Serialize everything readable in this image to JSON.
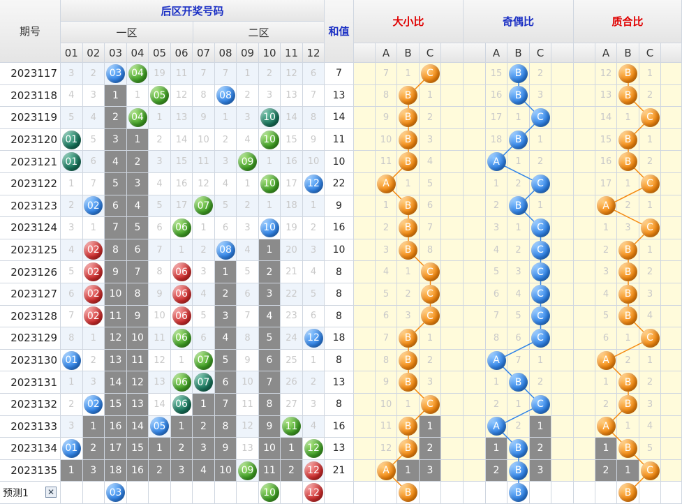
{
  "header": {
    "period_label": "期号",
    "back_zone_title": "后区开奖号码",
    "zone1_label": "一区",
    "zone2_label": "二区",
    "sum_label": "和值",
    "size_ratio_label": "大小比",
    "odd_even_label": "奇偶比",
    "prime_composite_label": "质合比",
    "number_columns": [
      "01",
      "02",
      "03",
      "04",
      "05",
      "06",
      "07",
      "08",
      "09",
      "10",
      "11",
      "12"
    ],
    "abc": [
      "A",
      "B",
      "C"
    ]
  },
  "chart_data": {
    "type": "table",
    "rows": [
      {
        "period": "2023117",
        "cells": [
          "3",
          "2",
          "03",
          "04",
          "19",
          "11",
          "7",
          "7",
          "1",
          "2",
          "12",
          "6"
        ],
        "sum": "7",
        "size": [
          "7",
          "1",
          "C"
        ],
        "parity": [
          "15",
          "B",
          "2"
        ],
        "prime": [
          "12",
          "B",
          "1"
        ]
      },
      {
        "period": "2023118",
        "cells": [
          "4",
          "3",
          "1",
          "1",
          "05",
          "12",
          "8",
          "08",
          "2",
          "3",
          "13",
          "7"
        ],
        "sum": "13",
        "size": [
          "8",
          "B",
          "1"
        ],
        "parity": [
          "16",
          "B",
          "3"
        ],
        "prime": [
          "13",
          "B",
          "2"
        ]
      },
      {
        "period": "2023119",
        "cells": [
          "5",
          "4",
          "2",
          "04",
          "1",
          "13",
          "9",
          "1",
          "3",
          "10",
          "14",
          "8"
        ],
        "sum": "14",
        "size": [
          "9",
          "B",
          "2"
        ],
        "parity": [
          "17",
          "1",
          "C"
        ],
        "prime": [
          "14",
          "1",
          "C"
        ]
      },
      {
        "period": "2023120",
        "cells": [
          "01",
          "5",
          "3",
          "1",
          "2",
          "14",
          "10",
          "2",
          "4",
          "10",
          "15",
          "9"
        ],
        "sum": "11",
        "size": [
          "10",
          "B",
          "3"
        ],
        "parity": [
          "18",
          "B",
          "1"
        ],
        "prime": [
          "15",
          "B",
          "1"
        ]
      },
      {
        "period": "2023121",
        "cells": [
          "01",
          "6",
          "4",
          "2",
          "3",
          "15",
          "11",
          "3",
          "09",
          "1",
          "16",
          "10"
        ],
        "sum": "10",
        "size": [
          "11",
          "B",
          "4"
        ],
        "parity": [
          "A",
          "1",
          "2"
        ],
        "prime": [
          "16",
          "B",
          "2"
        ]
      },
      {
        "period": "2023122",
        "cells": [
          "1",
          "7",
          "5",
          "3",
          "4",
          "16",
          "12",
          "4",
          "1",
          "10",
          "17",
          "12"
        ],
        "sum": "22",
        "size": [
          "A",
          "1",
          "5"
        ],
        "parity": [
          "1",
          "2",
          "C"
        ],
        "prime": [
          "17",
          "1",
          "C"
        ]
      },
      {
        "period": "2023123",
        "cells": [
          "2",
          "02",
          "6",
          "4",
          "5",
          "17",
          "07",
          "5",
          "2",
          "1",
          "18",
          "1"
        ],
        "sum": "9",
        "size": [
          "1",
          "B",
          "6"
        ],
        "parity": [
          "2",
          "B",
          "1"
        ],
        "prime": [
          "A",
          "2",
          "1"
        ]
      },
      {
        "period": "2023124",
        "cells": [
          "3",
          "1",
          "7",
          "5",
          "6",
          "06",
          "1",
          "6",
          "3",
          "10",
          "19",
          "2"
        ],
        "sum": "16",
        "size": [
          "2",
          "B",
          "7"
        ],
        "parity": [
          "3",
          "1",
          "C"
        ],
        "prime": [
          "1",
          "3",
          "C"
        ]
      },
      {
        "period": "2023125",
        "cells": [
          "4",
          "02",
          "8",
          "6",
          "7",
          "1",
          "2",
          "08",
          "4",
          "1",
          "20",
          "3"
        ],
        "sum": "10",
        "size": [
          "3",
          "B",
          "8"
        ],
        "parity": [
          "4",
          "2",
          "C"
        ],
        "prime": [
          "2",
          "B",
          "1"
        ]
      },
      {
        "period": "2023126",
        "cells": [
          "5",
          "02",
          "9",
          "7",
          "8",
          "06",
          "3",
          "1",
          "5",
          "2",
          "21",
          "4"
        ],
        "sum": "8",
        "size": [
          "4",
          "1",
          "C"
        ],
        "parity": [
          "5",
          "3",
          "C"
        ],
        "prime": [
          "3",
          "B",
          "2"
        ]
      },
      {
        "period": "2023127",
        "cells": [
          "6",
          "02",
          "10",
          "8",
          "9",
          "06",
          "4",
          "2",
          "6",
          "3",
          "22",
          "5"
        ],
        "sum": "8",
        "size": [
          "5",
          "2",
          "C"
        ],
        "parity": [
          "6",
          "4",
          "C"
        ],
        "prime": [
          "4",
          "B",
          "3"
        ]
      },
      {
        "period": "2023128",
        "cells": [
          "7",
          "02",
          "11",
          "9",
          "10",
          "06",
          "5",
          "3",
          "7",
          "4",
          "23",
          "6"
        ],
        "sum": "8",
        "size": [
          "6",
          "3",
          "C"
        ],
        "parity": [
          "7",
          "5",
          "C"
        ],
        "prime": [
          "5",
          "B",
          "4"
        ]
      },
      {
        "period": "2023129",
        "cells": [
          "8",
          "1",
          "12",
          "10",
          "11",
          "06",
          "6",
          "4",
          "8",
          "5",
          "24",
          "12"
        ],
        "sum": "18",
        "size": [
          "7",
          "B",
          "1"
        ],
        "parity": [
          "8",
          "6",
          "C"
        ],
        "prime": [
          "6",
          "1",
          "C"
        ]
      },
      {
        "period": "2023130",
        "cells": [
          "01",
          "2",
          "13",
          "11",
          "12",
          "1",
          "07",
          "5",
          "9",
          "6",
          "25",
          "1"
        ],
        "sum": "8",
        "size": [
          "8",
          "B",
          "2"
        ],
        "parity": [
          "A",
          "7",
          "1"
        ],
        "prime": [
          "A",
          "2",
          "1"
        ]
      },
      {
        "period": "2023131",
        "cells": [
          "1",
          "3",
          "14",
          "12",
          "13",
          "06",
          "07",
          "6",
          "10",
          "7",
          "26",
          "2"
        ],
        "sum": "13",
        "size": [
          "9",
          "B",
          "3"
        ],
        "parity": [
          "1",
          "B",
          "2"
        ],
        "prime": [
          "1",
          "B",
          "2"
        ]
      },
      {
        "period": "2023132",
        "cells": [
          "2",
          "02",
          "15",
          "13",
          "14",
          "06",
          "1",
          "7",
          "11",
          "8",
          "27",
          "3"
        ],
        "sum": "8",
        "size": [
          "10",
          "1",
          "C"
        ],
        "parity": [
          "2",
          "1",
          "C"
        ],
        "prime": [
          "2",
          "B",
          "3"
        ]
      },
      {
        "period": "2023133",
        "cells": [
          "3",
          "1",
          "16",
          "14",
          "05",
          "1",
          "2",
          "8",
          "12",
          "9",
          "11",
          "4"
        ],
        "sum": "16",
        "size": [
          "11",
          "B",
          "1"
        ],
        "parity": [
          "A",
          "2",
          "1"
        ],
        "prime": [
          "A",
          "1",
          "4"
        ]
      },
      {
        "period": "2023134",
        "cells": [
          "01",
          "2",
          "17",
          "15",
          "1",
          "2",
          "3",
          "9",
          "13",
          "10",
          "1",
          "12"
        ],
        "sum": "13",
        "size": [
          "12",
          "B",
          "2"
        ],
        "parity": [
          "1",
          "B",
          "2"
        ],
        "prime": [
          "1",
          "B",
          "5"
        ]
      },
      {
        "period": "2023135",
        "cells": [
          "1",
          "3",
          "18",
          "16",
          "2",
          "3",
          "4",
          "10",
          "09",
          "11",
          "2",
          "12"
        ],
        "sum": "21",
        "size": [
          "A",
          "1",
          "3"
        ],
        "parity": [
          "2",
          "B",
          "3"
        ],
        "prime": [
          "2",
          "1",
          "C"
        ]
      }
    ],
    "cell_styles": [
      [
        "n",
        "n",
        "blue",
        "green",
        "n",
        "n",
        "n",
        "n",
        "n",
        "n",
        "n",
        "n"
      ],
      [
        "n",
        "n",
        "gray",
        "n",
        "green",
        "n",
        "n",
        "blue",
        "n",
        "n",
        "n",
        "n"
      ],
      [
        "n",
        "n",
        "gray",
        "green",
        "n",
        "n",
        "n",
        "n",
        "n",
        "teal",
        "n",
        "n"
      ],
      [
        "teal",
        "n",
        "gray",
        "gray",
        "n",
        "n",
        "n",
        "n",
        "n",
        "green",
        "n",
        "n"
      ],
      [
        "teal",
        "n",
        "gray",
        "gray",
        "n",
        "n",
        "n",
        "n",
        "green",
        "n",
        "n",
        "n"
      ],
      [
        "n",
        "n",
        "gray",
        "gray",
        "n",
        "n",
        "n",
        "n",
        "n",
        "green",
        "n",
        "blue"
      ],
      [
        "n",
        "blue",
        "gray",
        "gray",
        "n",
        "n",
        "green",
        "n",
        "n",
        "n",
        "n",
        "n"
      ],
      [
        "n",
        "n",
        "gray",
        "gray",
        "n",
        "green",
        "n",
        "n",
        "n",
        "blue",
        "n",
        "n"
      ],
      [
        "n",
        "red",
        "gray",
        "gray",
        "n",
        "n",
        "n",
        "blue",
        "n",
        "gray",
        "n",
        "n"
      ],
      [
        "n",
        "red",
        "gray",
        "gray",
        "n",
        "red",
        "n",
        "gray",
        "n",
        "gray",
        "n",
        "n"
      ],
      [
        "n",
        "red",
        "gray",
        "gray",
        "n",
        "red",
        "n",
        "gray",
        "n",
        "gray",
        "n",
        "n"
      ],
      [
        "n",
        "red",
        "gray",
        "gray",
        "n",
        "red",
        "n",
        "gray",
        "n",
        "gray",
        "n",
        "n"
      ],
      [
        "n",
        "n",
        "gray",
        "gray",
        "n",
        "green",
        "n",
        "gray",
        "n",
        "gray",
        "n",
        "blue"
      ],
      [
        "blue",
        "n",
        "gray",
        "gray",
        "n",
        "n",
        "green",
        "gray",
        "n",
        "gray",
        "n",
        "n"
      ],
      [
        "n",
        "n",
        "gray",
        "gray",
        "n",
        "green",
        "teal",
        "gray",
        "n",
        "gray",
        "n",
        "n"
      ],
      [
        "n",
        "blue",
        "gray",
        "gray",
        "n",
        "teal",
        "gray",
        "gray",
        "n",
        "gray",
        "n",
        "n"
      ],
      [
        "n",
        "gray",
        "gray",
        "gray",
        "blue",
        "gray",
        "gray",
        "gray",
        "n",
        "gray",
        "green",
        "n"
      ],
      [
        "blue",
        "gray",
        "gray",
        "gray",
        "gray",
        "gray",
        "gray",
        "gray",
        "n",
        "gray",
        "gray",
        "green"
      ],
      [
        "gray",
        "gray",
        "gray",
        "gray",
        "gray",
        "gray",
        "gray",
        "gray",
        "green",
        "gray",
        "gray",
        "red"
      ]
    ],
    "ratio_styles": {
      "size": [
        [
          "n",
          "n",
          "ball"
        ],
        [
          "n",
          "ball",
          "n"
        ],
        [
          "n",
          "ball",
          "n"
        ],
        [
          "n",
          "ball",
          "n"
        ],
        [
          "n",
          "ball",
          "n"
        ],
        [
          "ball",
          "n",
          "n"
        ],
        [
          "n",
          "ball",
          "n"
        ],
        [
          "n",
          "ball",
          "n"
        ],
        [
          "n",
          "ball",
          "n"
        ],
        [
          "n",
          "n",
          "ball"
        ],
        [
          "n",
          "n",
          "ball"
        ],
        [
          "n",
          "n",
          "ball"
        ],
        [
          "n",
          "ball",
          "n"
        ],
        [
          "n",
          "ball",
          "n"
        ],
        [
          "n",
          "ball",
          "n"
        ],
        [
          "n",
          "n",
          "ball"
        ],
        [
          "n",
          "ball",
          "gray"
        ],
        [
          "n",
          "ball",
          "gray"
        ],
        [
          "ball",
          "gray",
          "gray"
        ]
      ],
      "parity": [
        [
          "n",
          "ball",
          "n"
        ],
        [
          "n",
          "ball",
          "n"
        ],
        [
          "n",
          "n",
          "ball"
        ],
        [
          "n",
          "ball",
          "n"
        ],
        [
          "ball",
          "n",
          "n"
        ],
        [
          "n",
          "n",
          "ball"
        ],
        [
          "n",
          "ball",
          "n"
        ],
        [
          "n",
          "n",
          "ball"
        ],
        [
          "n",
          "n",
          "ball"
        ],
        [
          "n",
          "n",
          "ball"
        ],
        [
          "n",
          "n",
          "ball"
        ],
        [
          "n",
          "n",
          "ball"
        ],
        [
          "n",
          "n",
          "ball"
        ],
        [
          "ball",
          "n",
          "n"
        ],
        [
          "n",
          "ball",
          "n"
        ],
        [
          "n",
          "n",
          "ball"
        ],
        [
          "ball",
          "n",
          "gray"
        ],
        [
          "gray",
          "ball",
          "gray"
        ],
        [
          "gray",
          "ball",
          "gray"
        ]
      ],
      "prime": [
        [
          "n",
          "ball",
          "n"
        ],
        [
          "n",
          "ball",
          "n"
        ],
        [
          "n",
          "n",
          "ball"
        ],
        [
          "n",
          "ball",
          "n"
        ],
        [
          "n",
          "ball",
          "n"
        ],
        [
          "n",
          "n",
          "ball"
        ],
        [
          "ball",
          "n",
          "n"
        ],
        [
          "n",
          "n",
          "ball"
        ],
        [
          "n",
          "ball",
          "n"
        ],
        [
          "n",
          "ball",
          "n"
        ],
        [
          "n",
          "ball",
          "n"
        ],
        [
          "n",
          "ball",
          "n"
        ],
        [
          "n",
          "n",
          "ball"
        ],
        [
          "ball",
          "n",
          "n"
        ],
        [
          "n",
          "ball",
          "n"
        ],
        [
          "n",
          "ball",
          "n"
        ],
        [
          "ball",
          "n",
          "n"
        ],
        [
          "gray",
          "ball",
          "n"
        ],
        [
          "gray",
          "gray",
          "ball"
        ]
      ]
    },
    "prediction": {
      "label": "预测1",
      "close_glyph": "✕",
      "balls": [
        {
          "col": 2,
          "text": "03",
          "color": "blue"
        },
        {
          "col": 9,
          "text": "10",
          "color": "green"
        },
        {
          "col": 11,
          "text": "12",
          "color": "red"
        }
      ],
      "size_ball": {
        "col": 1,
        "text": "B"
      },
      "parity_ball": {
        "col": 1,
        "text": "B"
      },
      "prime_ball": {
        "col": 1,
        "text": "B"
      }
    },
    "colors": {
      "blue_ball": "#2f83e8",
      "green_ball": "#3f9f24",
      "red_ball": "#cf2c2c",
      "teal_ball": "#17735a",
      "orange_ball": "#f5890f",
      "gray_cell": "#8b8b8b",
      "zone_bg": "#eef4fb",
      "ratio_bg": "#fffbdb",
      "size_line": "#f5890f",
      "parity_line": "#2f83e8",
      "prime_line": "#f5890f"
    }
  }
}
